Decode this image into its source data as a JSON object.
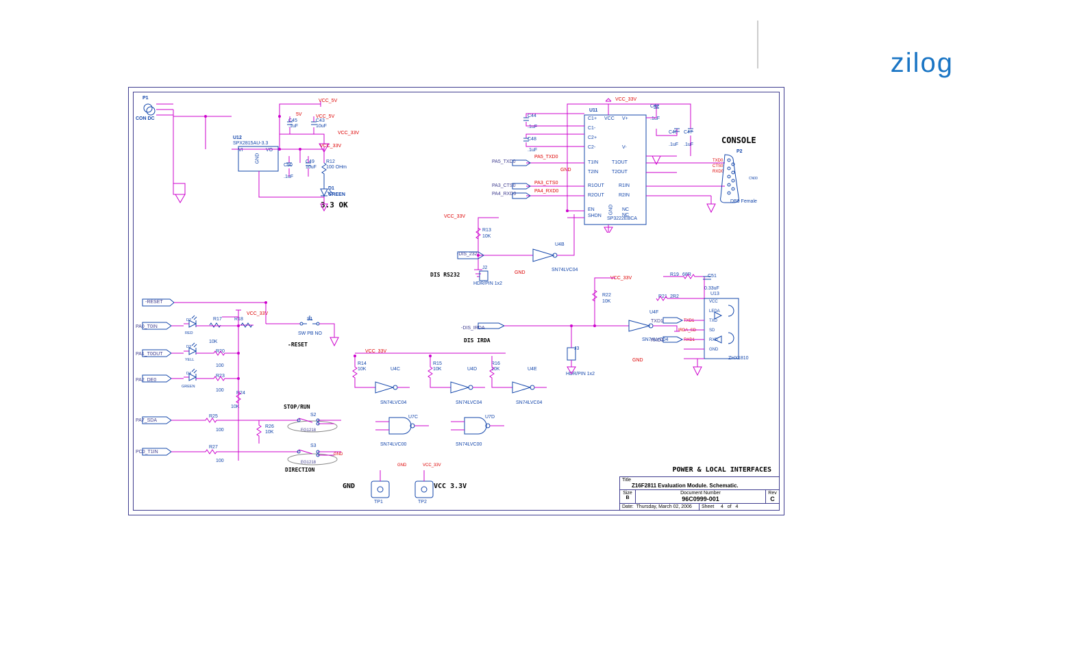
{
  "logo": {
    "z": "z",
    "rest": "ilog"
  },
  "titleblock": {
    "section_title": "POWER & LOCAL INTERFACES",
    "title_lbl": "Title",
    "title": "Z16F2811 Evaluation Module. Schematic.",
    "size_lbl": "Size",
    "size": "B",
    "docnum_lbl": "Document Number",
    "docnum": "96C0999-001",
    "rev_lbl": "Rev",
    "rev": "C",
    "date_lbl": "Date:",
    "date": "Thursday, March 02, 2006",
    "sheet_lbl": "Sheet",
    "sheet_cur": "4",
    "sheet_of": "of",
    "sheet_tot": "4"
  },
  "power_section": {
    "vcc5v": "VCC_5V",
    "vcc33v": "VCC_33V",
    "five_v": "5V",
    "p1": "P1",
    "con_dc": "CON DC",
    "u12": "U12",
    "u12_part": "SPX2815AU-3.3",
    "u12_vi": "VI",
    "u12_vo": "VO",
    "u12_gnd": "GND",
    "c45": "C45",
    "c45_v": ".1uF",
    "c43": "C43",
    "c43_v": "10uF",
    "c50": "C50",
    "c50_v": ".1uF",
    "c49": "C49",
    "c49_v": "10uF",
    "r12": "R12",
    "r12_v": "100 OHm",
    "d1": "D1",
    "d1_v": "GREEN",
    "pwr_ok": "3.3 OK"
  },
  "console": {
    "heading": "CONSOLE",
    "u11": "U11",
    "u11_part": "SP3222EBCA",
    "u11_pins": {
      "vcc": "VCC",
      "vplus": "V+",
      "vminus": "V-",
      "c1p": "C1+",
      "c1m": "C1-",
      "c2p": "C2+",
      "c2m": "C2-",
      "t1in": "T1IN",
      "t2in": "T2IN",
      "t1out": "T1OUT",
      "t2out": "T2OUT",
      "r1out": "R1OUT",
      "r1in": "R1IN",
      "r2out": "R2OUT",
      "r2in": "R2IN",
      "en": "EN",
      "shdn": "SHDN",
      "gnd": "GND",
      "nc1": "NC",
      "nc2": "NC"
    },
    "c44": "C44",
    "c44_v": ".1uF",
    "c48": "C48",
    "c48_v": ".1uF",
    "c42": "C42",
    "c42_v": ".1uF",
    "c46": "C46",
    "c46_v": ".1uF",
    "c47": "C47",
    "c47_v": ".1uF",
    "p2": "P2",
    "db9": "DB9 Female",
    "txd0": "TXD0",
    "cts0": "CTS0",
    "rxd0": "RXD0",
    "cn0": "CN00",
    "pa5_txd0": "PA5_TXD0",
    "pa5_txd0_net": "PA5_TXD0",
    "pa3_cts0": "PA3_CTS0",
    "pa3_cts0_net": "PA3_CTS0",
    "pa4_rxd0": "PA4_RXD0",
    "pa4_rxd0_net": "PA4_RXD0",
    "gnd_net": "GND"
  },
  "rs232": {
    "dis232": "-DIS_232",
    "heading": "DIS RS232",
    "j2": "J2",
    "hdr": "HDR/PIN 1x2",
    "gnd": "GND",
    "r13": "R13",
    "r13_v": "10K",
    "u4b": "U4B",
    "u4b_part": "SN74LVC04"
  },
  "irda": {
    "heading": "DIS IRDA",
    "j3": "J3",
    "hdr": "HDR/PIN 1x2",
    "dis_irda": "-DIS_IRDA",
    "r22": "R22",
    "r22_v": "10K",
    "u4f": "U4F",
    "u4f_part": "SN74LVC04",
    "r19": "R19",
    "r19_v": "68R",
    "r21": "R21",
    "r21_v": "2R2",
    "c51": "C51",
    "c51_v": "0.33uF",
    "u13": "U13",
    "u13_part": "ZHX1810",
    "u13_pins": {
      "vcc": "VCC",
      "leda": "LEDA",
      "txd": "TXD",
      "sd": "SD",
      "rxd": "RXD",
      "gnd": "GND"
    },
    "txd1": "TXD1",
    "irda_sd": "IRDA_SD",
    "rxd1": "RXD1",
    "gnd": "GND",
    "vcc33": "VCC_33V"
  },
  "reset": {
    "reset": "-RESET",
    "reset_lbl": "-RESET",
    "vcc33": "VCC_33V",
    "d2": "D2",
    "d2_c": "RED",
    "d3": "D3",
    "d3_c": "YELL",
    "d4": "D4",
    "d4_c": "GREEN",
    "r17": "R17",
    "r18": "R18",
    "r20": "R20",
    "r20_v": "100",
    "r23": "R23",
    "r23_v": "100",
    "r24": "R24",
    "r24_v": "10K",
    "r25": "R25",
    "r25_v": "100",
    "r26": "R26",
    "r26_v": "10K",
    "r27": "R27",
    "r27_v": "100",
    "tenk": "10K",
    "s1": "S1",
    "s1_t": "SW PB NO",
    "stop_run": "STOP/RUN",
    "direction": "DIRECTION",
    "s2": "S2",
    "s3": "S3",
    "eg1218_1": "EG1218",
    "eg1218_2": "EG1218",
    "pa0": "PA0_T0IN",
    "pa1_out": "PA1_T0OUT",
    "pa2_de0": "PA2_DE0",
    "pa7_sda": "PA7_SDA",
    "pc0_t1in": "PC0_T1IN",
    "gnd": "GND"
  },
  "gates": {
    "vcc33": "VCC_33V",
    "r14": "R14",
    "r14_v": "10K",
    "r15": "R15",
    "r15_v": "10K",
    "r16": "R16",
    "r16_v": "10K",
    "u4c": "U4C",
    "u4d": "U4D",
    "u4e": "U4E",
    "sn74lvc04": "SN74LVC04",
    "u7c": "U7C",
    "u7d": "U7D",
    "sn74lvc00": "SN74LVC00"
  },
  "testpoints": {
    "gnd": "GND",
    "vcc33": "VCC 3.3V",
    "tp1": "TP1",
    "tp2": "TP2",
    "gnd_net": "GND",
    "vcc33_net": "VCC_33V"
  }
}
